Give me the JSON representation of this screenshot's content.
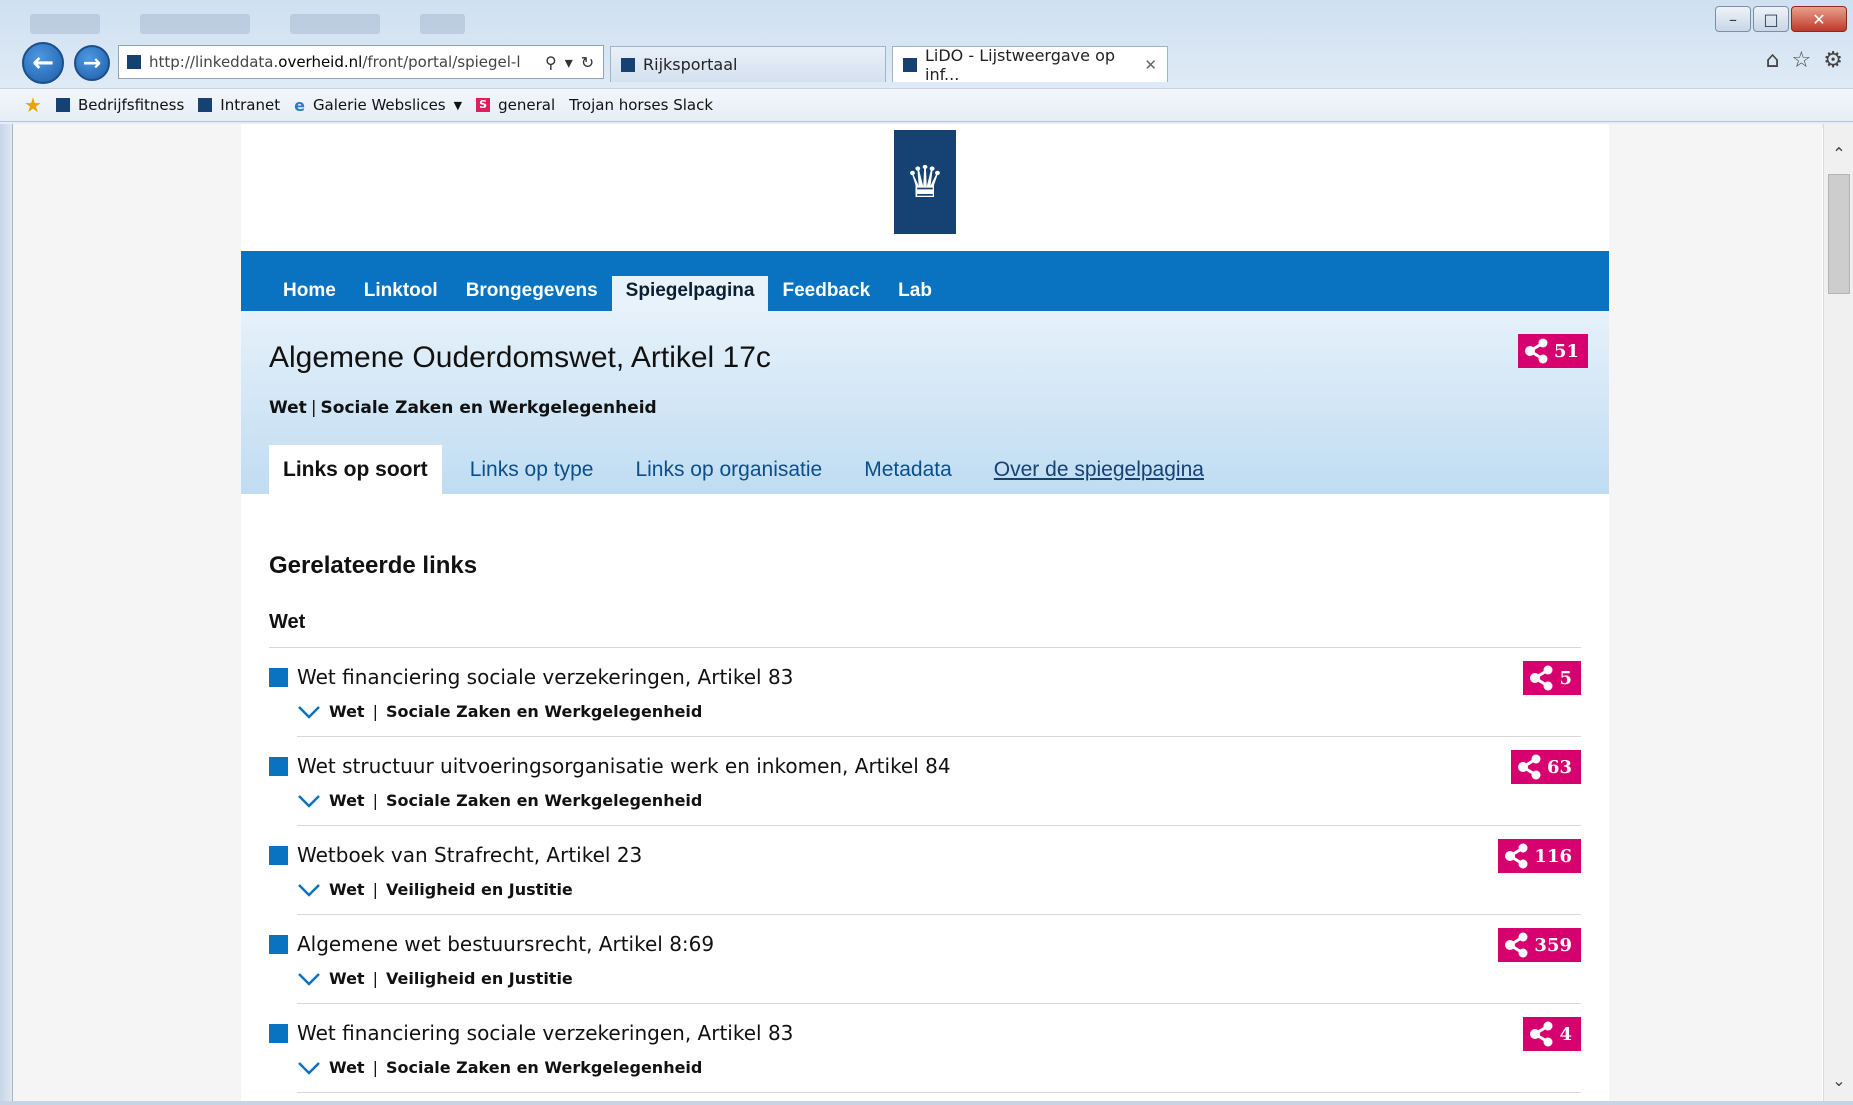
{
  "browser": {
    "address_url_prefix": "http://linkeddata.",
    "address_url_domain": "overheid.nl",
    "address_url_suffix": "/front/portal/spiegel-l",
    "tabs": [
      {
        "label": "Rijksportaal"
      },
      {
        "label": "LiDO - Lijstweergave op inf..."
      }
    ],
    "favorites": [
      {
        "label": "Bedrijfsfitness"
      },
      {
        "label": "Intranet"
      },
      {
        "label": "Galerie Webslices"
      },
      {
        "label": "general"
      },
      {
        "label": "Trojan horses Slack"
      }
    ],
    "colors": {
      "chrome": "#dde9f5"
    }
  },
  "site": {
    "nav": [
      {
        "label": "Home"
      },
      {
        "label": "Linktool"
      },
      {
        "label": "Brongegevens"
      },
      {
        "label": "Spiegelpagina"
      },
      {
        "label": "Feedback"
      },
      {
        "label": "Lab"
      }
    ],
    "active_nav": "Spiegelpagina",
    "colors": {
      "nav": "#0a73c1",
      "badge": "#d6006f",
      "logo": "#154273"
    }
  },
  "document": {
    "title": "Algemene Ouderdomswet, Artikel 17c",
    "type": "Wet",
    "separator": "|",
    "ministry": "Sociale Zaken en Werkgelegenheid",
    "link_count": "51"
  },
  "subtabs": [
    {
      "label": "Links op soort"
    },
    {
      "label": "Links op type"
    },
    {
      "label": "Links op organisatie"
    },
    {
      "label": "Metadata"
    },
    {
      "label": "Over de spiegelpagina"
    }
  ],
  "related": {
    "heading": "Gerelateerde links",
    "group": "Wet",
    "items": [
      {
        "title": "Wet financiering sociale verzekeringen, Artikel 83",
        "type": "Wet",
        "org": "Sociale Zaken en Werkgelegenheid",
        "count": "5"
      },
      {
        "title": "Wet structuur uitvoeringsorganisatie werk en inkomen, Artikel 84",
        "type": "Wet",
        "org": "Sociale Zaken en Werkgelegenheid",
        "count": "63"
      },
      {
        "title": "Wetboek van Strafrecht, Artikel 23",
        "type": "Wet",
        "org": "Veiligheid en Justitie",
        "count": "116"
      },
      {
        "title": "Algemene wet bestuursrecht, Artikel 8:69",
        "type": "Wet",
        "org": "Veiligheid en Justitie",
        "count": "359"
      },
      {
        "title": "Wet financiering sociale verzekeringen, Artikel 83",
        "type": "Wet",
        "org": "Sociale Zaken en Werkgelegenheid",
        "count": "4"
      }
    ]
  },
  "icons": [
    "back-arrow-icon",
    "forward-arrow-icon",
    "search-icon",
    "refresh-icon",
    "home-icon",
    "star-icon",
    "gear-icon",
    "share-icon",
    "chevron-down-icon",
    "crown-logo-icon"
  ]
}
